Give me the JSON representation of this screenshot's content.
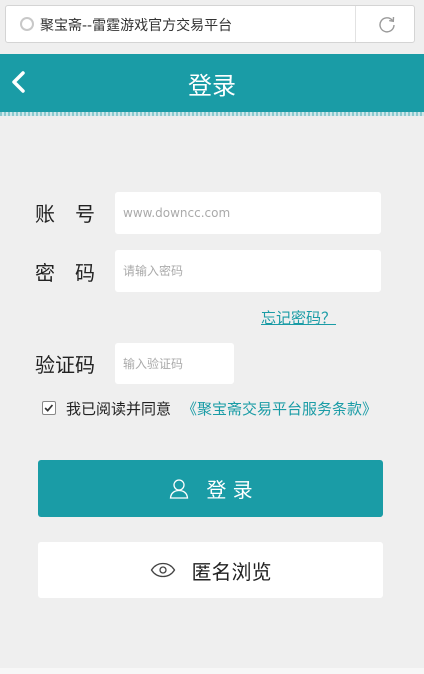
{
  "browser": {
    "page_title": "聚宝斋--雷霆游戏官方交易平台",
    "site_icon": "globe-icon",
    "reload_icon": "reload-icon"
  },
  "header": {
    "back_icon": "chevron-left-icon",
    "title": "登录",
    "color": "#1a9ca6"
  },
  "form": {
    "account_label": "账　号",
    "account_placeholder": "www.downcc.com",
    "password_label": "密　码",
    "password_placeholder": "请输入密码",
    "forgot_link": "忘记密码？",
    "captcha_label": "验证码",
    "captcha_placeholder": "输入验证码",
    "agree_checked": true,
    "agree_text": "我已阅读并同意",
    "terms_link": "《聚宝斋交易平台服务条款》"
  },
  "buttons": {
    "login_label": "登 录",
    "login_icon": "user-icon",
    "anonymous_label": "匿名浏览",
    "anonymous_icon": "eye-icon"
  }
}
